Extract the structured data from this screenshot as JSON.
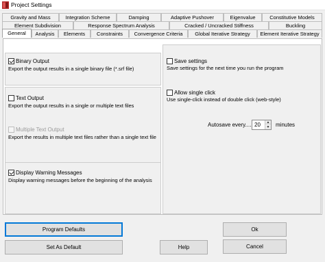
{
  "window": {
    "title": "Project Settings"
  },
  "tabs_row1": [
    "Gravity and Mass",
    "Integration Scheme",
    "Damping",
    "Adaptive Pushover",
    "Eigenvalue",
    "Constitutive Models"
  ],
  "tabs_row2": [
    "Element Subdivision",
    "Response Spectrum Analysis",
    "Cracked / Uncracked Stiffness",
    "Buckling"
  ],
  "tabs_row3": [
    "General",
    "Analysis",
    "Elements",
    "Constraints",
    "Convergence Criteria",
    "Global Iterative Strategy",
    "Element Iterative Strategy"
  ],
  "active_tab": "General",
  "left": {
    "binary_output": {
      "label": "Binary Output",
      "checked": true,
      "desc": "Export the output results in a single binary file (*.srf file)"
    },
    "text_output": {
      "label": "Text Output",
      "checked": false,
      "desc": "Export the output results in a single or multiple text files"
    },
    "multiple_text_output": {
      "label": "Multiple Text Output",
      "checked": false,
      "enabled": false,
      "desc": "Export the results in multiple text files rather than a single text file"
    },
    "display_warnings": {
      "label": "Display Warning Messages",
      "checked": true,
      "desc": "Display warning messages before the beginning of the analysis"
    }
  },
  "right": {
    "save_settings": {
      "label": "Save settings",
      "checked": false,
      "desc": "Save settings for the next time you run the program"
    },
    "single_click": {
      "label": "Allow single click",
      "checked": false,
      "desc": "Use single-click instead of double click (web-style)"
    },
    "autosave": {
      "label": "Autosave every....",
      "value": "20",
      "unit": "minutes"
    }
  },
  "buttons": {
    "program_defaults": "Program Defaults",
    "set_as_default": "Set As Default",
    "help": "Help",
    "ok": "Ok",
    "cancel": "Cancel"
  },
  "colors": {
    "focus": "#0078d7",
    "app_icon": "#c0392b"
  }
}
